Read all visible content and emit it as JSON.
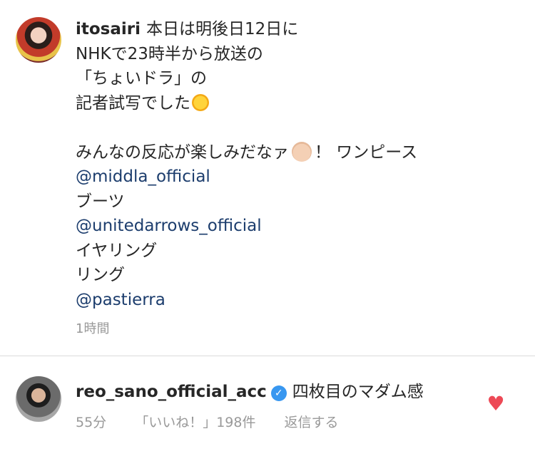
{
  "post": {
    "username": "itosairi",
    "lines": [
      "本日は明後日12日に",
      "NHKで23時半から放送の",
      "「ちょいドラ」の",
      "記者試写でした"
    ],
    "line5_before": "みんなの反応が楽しみだなァ",
    "line5_after": "！ ワンピース",
    "mention1": "@middla_official",
    "line_boots": "ブーツ",
    "mention2": "@unitedarrows_official",
    "line_earring": "イヤリング",
    "line_ring": "リング",
    "mention3": "@pastierra",
    "time": "1時間",
    "emoji1": "sun-emoji",
    "emoji2": "baby-emoji"
  },
  "comment": {
    "username": "reo_sano_official_acc",
    "verified_icon": "verified-badge-icon",
    "text": "四枚目のマダム感",
    "time": "55分",
    "likes": "「いいね！」198件",
    "reply": "返信する",
    "like_icon": "heart-icon",
    "heart_color": "#ed4956"
  },
  "colors": {
    "mention": "#1c3d6d",
    "meta": "#999999",
    "verified": "#3897f0"
  }
}
